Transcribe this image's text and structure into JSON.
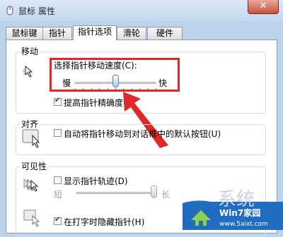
{
  "window": {
    "title": "鼠标 属性",
    "close_glyph": "✕"
  },
  "tabs": [
    {
      "label": "鼠标键",
      "active": false
    },
    {
      "label": "指针",
      "active": false
    },
    {
      "label": "指针选项",
      "active": true
    },
    {
      "label": "滑轮",
      "active": false
    },
    {
      "label": "硬件",
      "active": false
    }
  ],
  "motion": {
    "group_title": "移动",
    "speed_label": "选择指针移动速度(C):",
    "slow_label": "慢",
    "fast_label": "快",
    "speed_level": 0.5,
    "precision_label": "提高指针精确度(E)",
    "precision_checked": true
  },
  "snap": {
    "group_title": "对齐",
    "snap_label": "自动将指针移动到对话框中的默认按钮(U)",
    "snap_checked": false
  },
  "visibility": {
    "group_title": "可见性",
    "trails_label": "显示指针轨迹(D)",
    "trails_checked": false,
    "short_label": "短",
    "long_label": "长",
    "trails_level": 1.0,
    "hide_typing_label": "在打字时隐藏指针(H)",
    "hide_typing_checked": true
  },
  "watermark": {
    "brand": "Win7家园",
    "site": "www.5aixt.com",
    "partial_text": "系统"
  },
  "colors": {
    "highlight_box": "#e02828",
    "arrow": "#e02828",
    "watermark_bg": "#1f6cc0"
  }
}
